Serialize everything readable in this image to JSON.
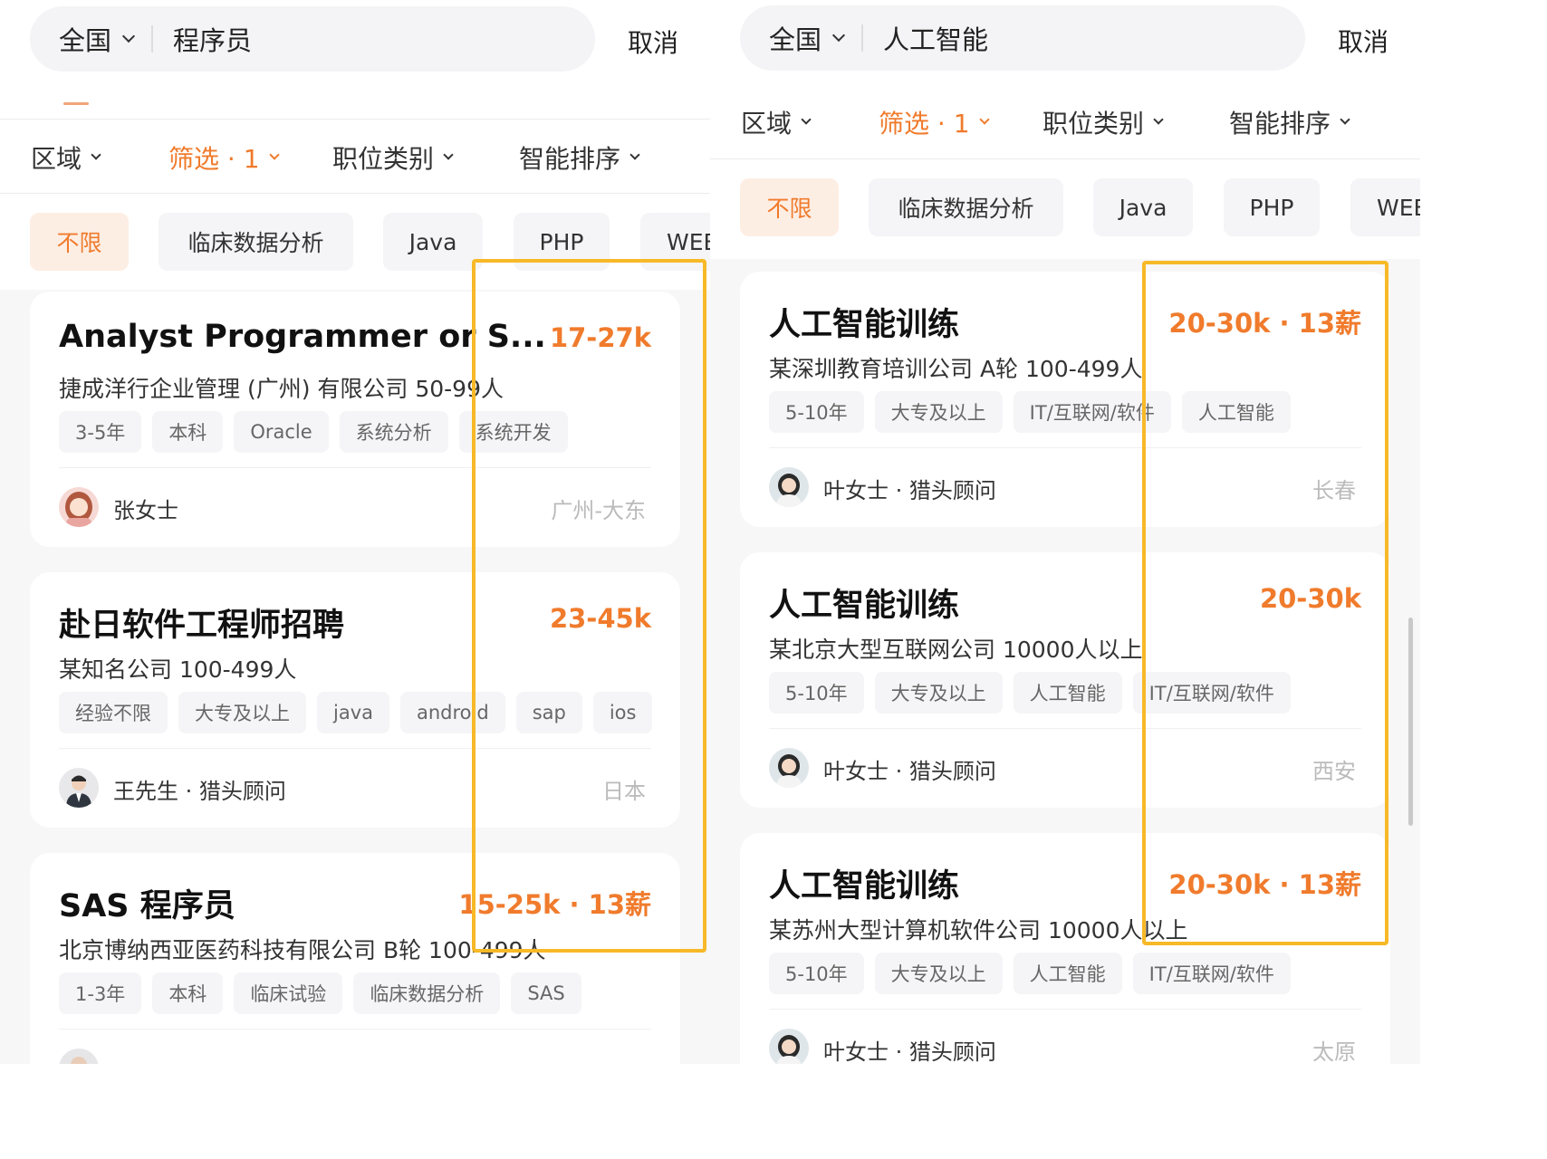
{
  "left": {
    "search": {
      "city": "全国",
      "query": "程序员",
      "cancel": "取消"
    },
    "filters": [
      {
        "label": "区域"
      },
      {
        "label": "筛选 · 1"
      },
      {
        "label": "职位类别"
      },
      {
        "label": "智能排序"
      }
    ],
    "chips": [
      "不限",
      "临床数据分析",
      "Java",
      "PHP",
      "WEB"
    ],
    "jobs": [
      {
        "title": "Analyst Programmer or S...",
        "salary": "17-27k",
        "company": "捷成洋行企业管理 (广州) 有限公司   50-99人",
        "tags": [
          "3-5年",
          "本科",
          "Oracle",
          "系统分析",
          "系统开发"
        ],
        "person": "张女士",
        "location": "广州-大东"
      },
      {
        "title": "赴日软件工程师招聘",
        "salary": "23-45k",
        "company": "某知名公司   100-499人",
        "tags": [
          "经验不限",
          "大专及以上",
          "java",
          "android",
          "sap",
          "ios"
        ],
        "person": "王先生 · 猎头顾问",
        "location": "日本"
      },
      {
        "title": "SAS 程序员",
        "salary": "15-25k · 13薪",
        "company": "北京博纳西亚医药科技有限公司   B轮   100-499人",
        "tags": [
          "1-3年",
          "本科",
          "临床试验",
          "临床数据分析",
          "SAS"
        ],
        "person": "",
        "location": ""
      }
    ]
  },
  "right": {
    "search": {
      "city": "全国",
      "query": "人工智能",
      "cancel": "取消"
    },
    "filters": [
      {
        "label": "区域"
      },
      {
        "label": "筛选 · 1"
      },
      {
        "label": "职位类别"
      },
      {
        "label": "智能排序"
      }
    ],
    "chips": [
      "不限",
      "临床数据分析",
      "Java",
      "PHP",
      "WEB"
    ],
    "jobs": [
      {
        "title": "人工智能训练",
        "salary": "20-30k · 13薪",
        "company": "某深圳教育培训公司   A轮   100-499人",
        "tags": [
          "5-10年",
          "大专及以上",
          "IT/互联网/软件",
          "人工智能"
        ],
        "person": "叶女士 · 猎头顾问",
        "location": "长春"
      },
      {
        "title": "人工智能训练",
        "salary": "20-30k",
        "company": "某北京大型互联网公司   10000人以上",
        "tags": [
          "5-10年",
          "大专及以上",
          "人工智能",
          "IT/互联网/软件"
        ],
        "person": "叶女士 · 猎头顾问",
        "location": "西安"
      },
      {
        "title": "人工智能训练",
        "salary": "20-30k · 13薪",
        "company": "某苏州大型计算机软件公司   10000人以上",
        "tags": [
          "5-10年",
          "大专及以上",
          "人工智能",
          "IT/互联网/软件"
        ],
        "person": "叶女士 · 猎头顾问",
        "location": "太原"
      }
    ]
  },
  "colors": {
    "accent": "#f07b2c",
    "highlight_box": "#f7b928",
    "chip_bg": "#f5f5f7",
    "active_chip_bg": "#fdeee4",
    "page_bg": "#f7f7f7"
  }
}
